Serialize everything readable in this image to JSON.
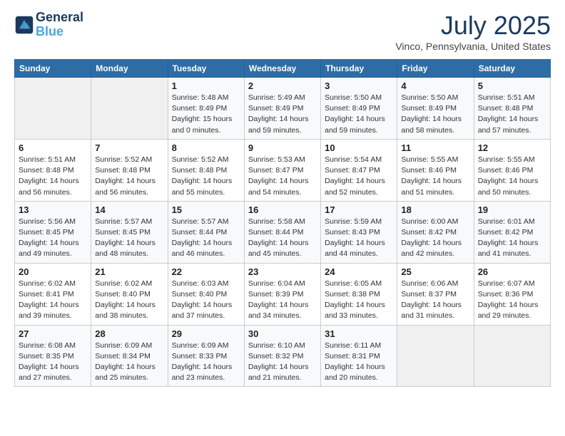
{
  "header": {
    "logo_line1": "General",
    "logo_line2": "Blue",
    "main_title": "July 2025",
    "subtitle": "Vinco, Pennsylvania, United States"
  },
  "days_of_week": [
    "Sunday",
    "Monday",
    "Tuesday",
    "Wednesday",
    "Thursday",
    "Friday",
    "Saturday"
  ],
  "weeks": [
    [
      {
        "day": "",
        "empty": true
      },
      {
        "day": "",
        "empty": true
      },
      {
        "day": "1",
        "sunrise": "Sunrise: 5:48 AM",
        "sunset": "Sunset: 8:49 PM",
        "daylight": "Daylight: 15 hours and 0 minutes."
      },
      {
        "day": "2",
        "sunrise": "Sunrise: 5:49 AM",
        "sunset": "Sunset: 8:49 PM",
        "daylight": "Daylight: 14 hours and 59 minutes."
      },
      {
        "day": "3",
        "sunrise": "Sunrise: 5:50 AM",
        "sunset": "Sunset: 8:49 PM",
        "daylight": "Daylight: 14 hours and 59 minutes."
      },
      {
        "day": "4",
        "sunrise": "Sunrise: 5:50 AM",
        "sunset": "Sunset: 8:49 PM",
        "daylight": "Daylight: 14 hours and 58 minutes."
      },
      {
        "day": "5",
        "sunrise": "Sunrise: 5:51 AM",
        "sunset": "Sunset: 8:48 PM",
        "daylight": "Daylight: 14 hours and 57 minutes."
      }
    ],
    [
      {
        "day": "6",
        "sunrise": "Sunrise: 5:51 AM",
        "sunset": "Sunset: 8:48 PM",
        "daylight": "Daylight: 14 hours and 56 minutes."
      },
      {
        "day": "7",
        "sunrise": "Sunrise: 5:52 AM",
        "sunset": "Sunset: 8:48 PM",
        "daylight": "Daylight: 14 hours and 56 minutes."
      },
      {
        "day": "8",
        "sunrise": "Sunrise: 5:52 AM",
        "sunset": "Sunset: 8:48 PM",
        "daylight": "Daylight: 14 hours and 55 minutes."
      },
      {
        "day": "9",
        "sunrise": "Sunrise: 5:53 AM",
        "sunset": "Sunset: 8:47 PM",
        "daylight": "Daylight: 14 hours and 54 minutes."
      },
      {
        "day": "10",
        "sunrise": "Sunrise: 5:54 AM",
        "sunset": "Sunset: 8:47 PM",
        "daylight": "Daylight: 14 hours and 52 minutes."
      },
      {
        "day": "11",
        "sunrise": "Sunrise: 5:55 AM",
        "sunset": "Sunset: 8:46 PM",
        "daylight": "Daylight: 14 hours and 51 minutes."
      },
      {
        "day": "12",
        "sunrise": "Sunrise: 5:55 AM",
        "sunset": "Sunset: 8:46 PM",
        "daylight": "Daylight: 14 hours and 50 minutes."
      }
    ],
    [
      {
        "day": "13",
        "sunrise": "Sunrise: 5:56 AM",
        "sunset": "Sunset: 8:45 PM",
        "daylight": "Daylight: 14 hours and 49 minutes."
      },
      {
        "day": "14",
        "sunrise": "Sunrise: 5:57 AM",
        "sunset": "Sunset: 8:45 PM",
        "daylight": "Daylight: 14 hours and 48 minutes."
      },
      {
        "day": "15",
        "sunrise": "Sunrise: 5:57 AM",
        "sunset": "Sunset: 8:44 PM",
        "daylight": "Daylight: 14 hours and 46 minutes."
      },
      {
        "day": "16",
        "sunrise": "Sunrise: 5:58 AM",
        "sunset": "Sunset: 8:44 PM",
        "daylight": "Daylight: 14 hours and 45 minutes."
      },
      {
        "day": "17",
        "sunrise": "Sunrise: 5:59 AM",
        "sunset": "Sunset: 8:43 PM",
        "daylight": "Daylight: 14 hours and 44 minutes."
      },
      {
        "day": "18",
        "sunrise": "Sunrise: 6:00 AM",
        "sunset": "Sunset: 8:42 PM",
        "daylight": "Daylight: 14 hours and 42 minutes."
      },
      {
        "day": "19",
        "sunrise": "Sunrise: 6:01 AM",
        "sunset": "Sunset: 8:42 PM",
        "daylight": "Daylight: 14 hours and 41 minutes."
      }
    ],
    [
      {
        "day": "20",
        "sunrise": "Sunrise: 6:02 AM",
        "sunset": "Sunset: 8:41 PM",
        "daylight": "Daylight: 14 hours and 39 minutes."
      },
      {
        "day": "21",
        "sunrise": "Sunrise: 6:02 AM",
        "sunset": "Sunset: 8:40 PM",
        "daylight": "Daylight: 14 hours and 38 minutes."
      },
      {
        "day": "22",
        "sunrise": "Sunrise: 6:03 AM",
        "sunset": "Sunset: 8:40 PM",
        "daylight": "Daylight: 14 hours and 37 minutes."
      },
      {
        "day": "23",
        "sunrise": "Sunrise: 6:04 AM",
        "sunset": "Sunset: 8:39 PM",
        "daylight": "Daylight: 14 hours and 34 minutes."
      },
      {
        "day": "24",
        "sunrise": "Sunrise: 6:05 AM",
        "sunset": "Sunset: 8:38 PM",
        "daylight": "Daylight: 14 hours and 33 minutes."
      },
      {
        "day": "25",
        "sunrise": "Sunrise: 6:06 AM",
        "sunset": "Sunset: 8:37 PM",
        "daylight": "Daylight: 14 hours and 31 minutes."
      },
      {
        "day": "26",
        "sunrise": "Sunrise: 6:07 AM",
        "sunset": "Sunset: 8:36 PM",
        "daylight": "Daylight: 14 hours and 29 minutes."
      }
    ],
    [
      {
        "day": "27",
        "sunrise": "Sunrise: 6:08 AM",
        "sunset": "Sunset: 8:35 PM",
        "daylight": "Daylight: 14 hours and 27 minutes."
      },
      {
        "day": "28",
        "sunrise": "Sunrise: 6:09 AM",
        "sunset": "Sunset: 8:34 PM",
        "daylight": "Daylight: 14 hours and 25 minutes."
      },
      {
        "day": "29",
        "sunrise": "Sunrise: 6:09 AM",
        "sunset": "Sunset: 8:33 PM",
        "daylight": "Daylight: 14 hours and 23 minutes."
      },
      {
        "day": "30",
        "sunrise": "Sunrise: 6:10 AM",
        "sunset": "Sunset: 8:32 PM",
        "daylight": "Daylight: 14 hours and 21 minutes."
      },
      {
        "day": "31",
        "sunrise": "Sunrise: 6:11 AM",
        "sunset": "Sunset: 8:31 PM",
        "daylight": "Daylight: 14 hours and 20 minutes."
      },
      {
        "day": "",
        "empty": true
      },
      {
        "day": "",
        "empty": true
      }
    ]
  ]
}
